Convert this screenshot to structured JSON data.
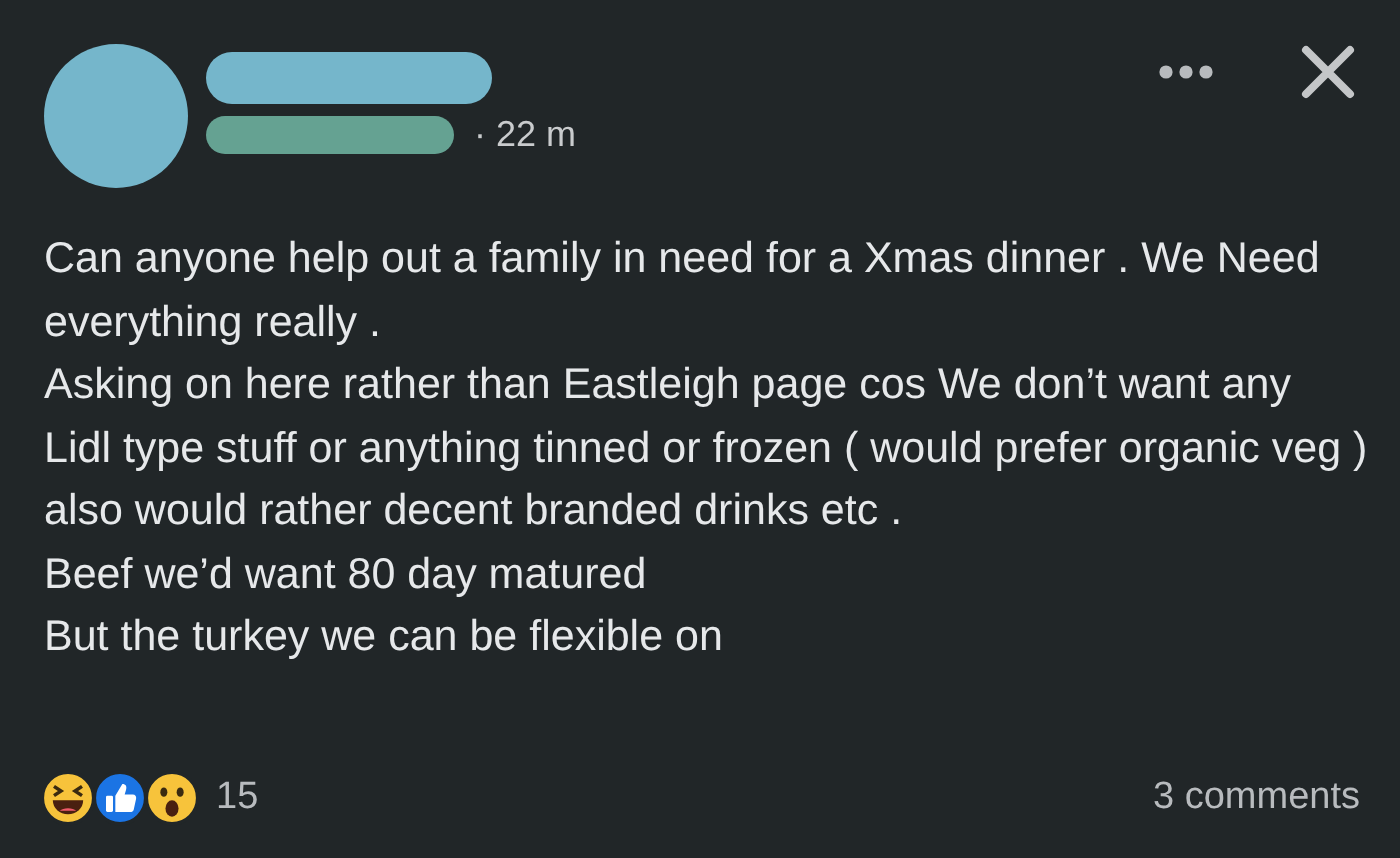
{
  "post": {
    "time": "· 22 m",
    "paragraphs": [
      "Can anyone help out a family in need for a Xmas dinner . We Need everything really .",
      "Asking on here rather than Eastleigh page cos We don’t want any Lidl type  stuff  or anything tinned or frozen ( would prefer organic veg ) also would rather decent  branded drinks etc .",
      "Beef we’d want 80 day matured",
      "But the turkey we can be flexible on"
    ],
    "reactions": [
      {
        "kind": "haha"
      },
      {
        "kind": "like"
      },
      {
        "kind": "wow"
      }
    ],
    "reaction_count": "15",
    "comments": "3 comments"
  }
}
